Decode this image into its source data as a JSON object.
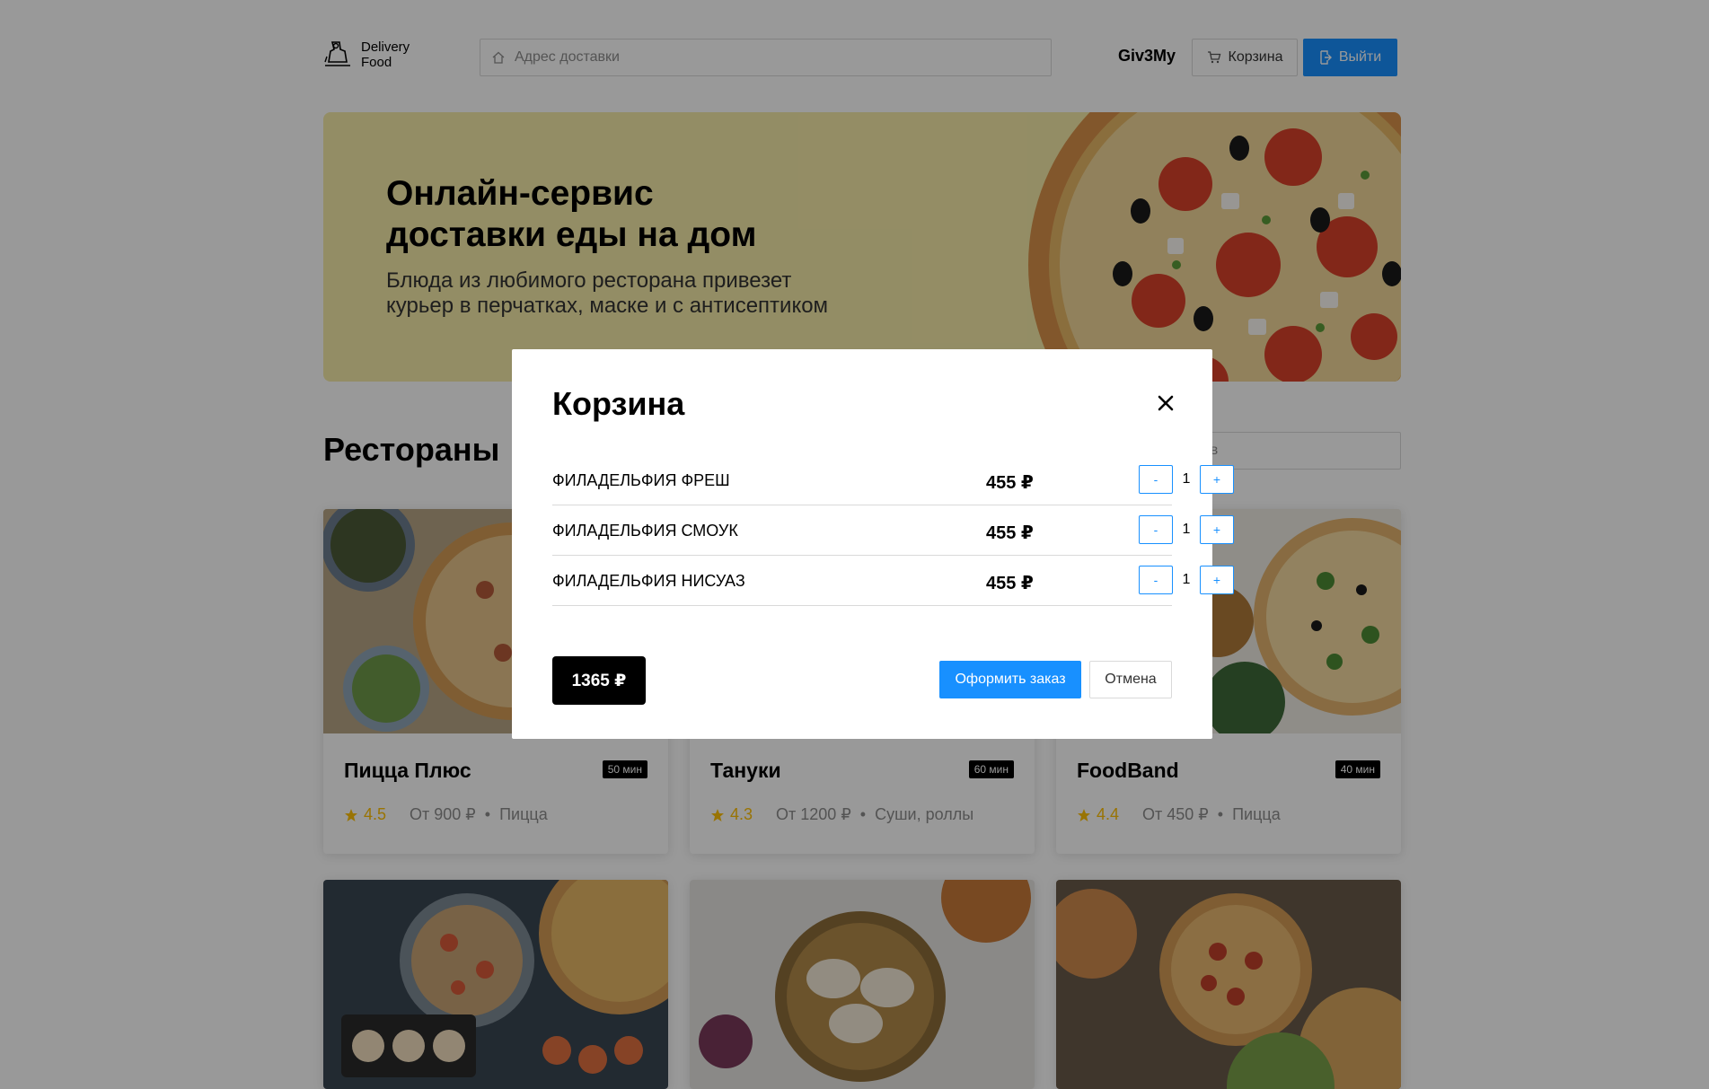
{
  "header": {
    "logo_line1": "Delivery",
    "logo_line2": "Food",
    "address_placeholder": "Адрес доставки",
    "user_name": "Giv3My",
    "cart_label": "Корзина",
    "logout_label": "Выйти"
  },
  "promo": {
    "title_line1": "Онлайн-сервис",
    "title_line2": "доставки еды на дом",
    "text_line1": "Блюда из любимого ресторана привезет",
    "text_line2": "курьер в перчатках, маске и с антисептиком"
  },
  "restaurants": {
    "title": "Рестораны",
    "search_placeholder": "Поиск блюд и ресторанов",
    "cards": [
      {
        "name": "Пицца Плюс",
        "time": "50 мин",
        "rating": "4.5",
        "price": "От 900 ₽",
        "category": "Пицца"
      },
      {
        "name": "Тануки",
        "time": "60 мин",
        "rating": "4.3",
        "price": "От 1200 ₽",
        "category": "Суши, роллы"
      },
      {
        "name": "FoodBand",
        "time": "40 мин",
        "rating": "4.4",
        "price": "От 450 ₽",
        "category": "Пицца"
      }
    ]
  },
  "modal": {
    "title": "Корзина",
    "items": [
      {
        "name": "ФИЛАДЕЛЬФИЯ ФРЕШ",
        "price": "455 ₽",
        "qty": "1"
      },
      {
        "name": "ФИЛАДЕЛЬФИЯ СМОУК",
        "price": "455 ₽",
        "qty": "1"
      },
      {
        "name": "ФИЛАДЕЛЬФИЯ НИСУАЗ",
        "price": "455 ₽",
        "qty": "1"
      }
    ],
    "minus_label": "-",
    "plus_label": "+",
    "total": "1365 ₽",
    "order_label": "Оформить заказ",
    "cancel_label": "Отмена"
  },
  "colors": {
    "accent": "#1890ff",
    "promo_bg": "#f6eba8",
    "star": "#ffc107"
  }
}
